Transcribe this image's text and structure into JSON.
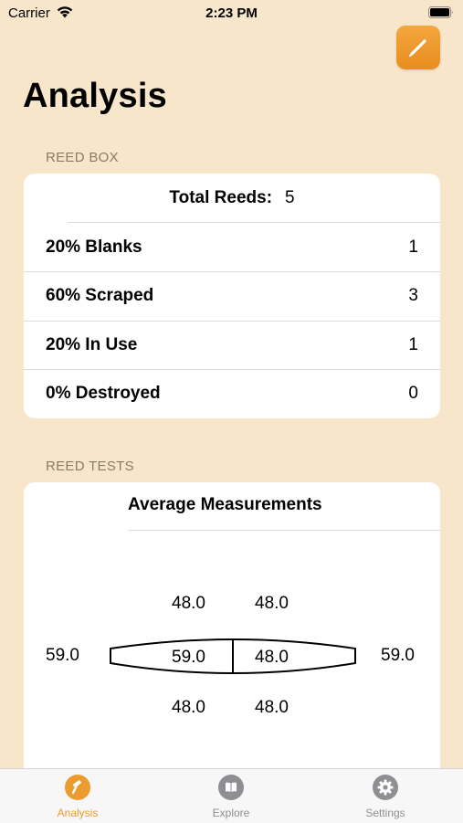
{
  "status_bar": {
    "carrier": "Carrier",
    "time": "2:23 PM"
  },
  "header": {
    "title": "Analysis",
    "edit_icon": "pencil-icon"
  },
  "reed_box": {
    "section_title": "REED BOX",
    "total_label": "Total Reeds:",
    "total_value": "5",
    "rows": [
      {
        "label": "20% Blanks",
        "value": "1"
      },
      {
        "label": "60% Scraped",
        "value": "3"
      },
      {
        "label": "20% In Use",
        "value": "1"
      },
      {
        "label": "0% Destroyed",
        "value": "0"
      }
    ]
  },
  "reed_tests": {
    "section_title": "REED TESTS",
    "card_title": "Average Measurements",
    "top_left": "48.0",
    "top_right": "48.0",
    "outer_left": "59.0",
    "inner_left": "59.0",
    "inner_right": "48.0",
    "outer_right": "59.0",
    "bottom_left": "48.0",
    "bottom_right": "48.0"
  },
  "tab_bar": {
    "tabs": [
      {
        "label": "Analysis",
        "icon": "hammer-icon",
        "active": true
      },
      {
        "label": "Explore",
        "icon": "book-icon",
        "active": false
      },
      {
        "label": "Settings",
        "icon": "gear-icon",
        "active": false
      }
    ]
  },
  "colors": {
    "background": "#f8e6cb",
    "accent": "#ec9b2f",
    "inactive_tab": "#8e8e93"
  }
}
